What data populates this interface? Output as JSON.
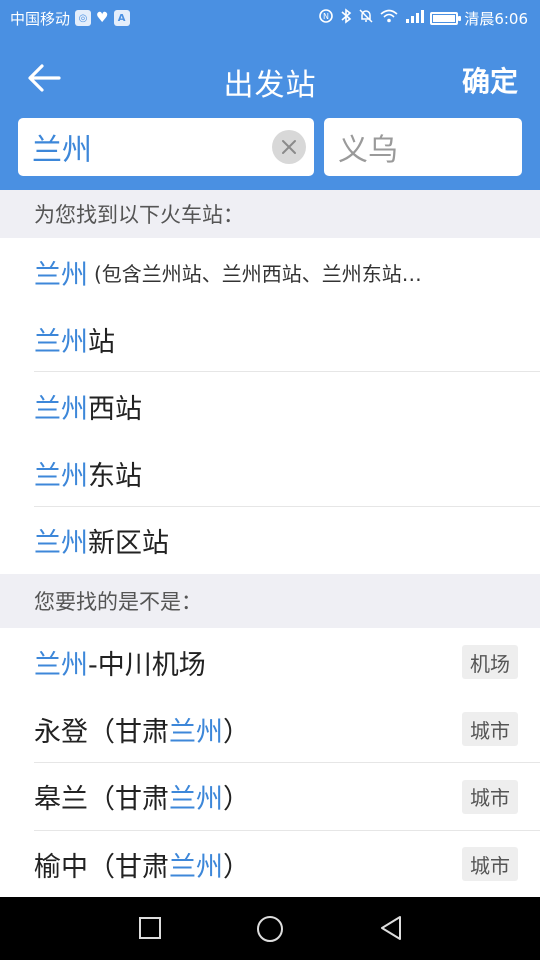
{
  "status_bar": {
    "carrier": "中国移动",
    "box1": "◎",
    "box2": "A",
    "time": "清晨6:06"
  },
  "header": {
    "title": "出发站",
    "confirm_label": "确定"
  },
  "search": {
    "from_value": "兰州",
    "to_value": "义乌"
  },
  "section1": {
    "header": "为您找到以下火车站："
  },
  "stations": [
    {
      "highlight": "兰州",
      "text": "(包含兰州站、兰州西站、兰州东站…"
    },
    {
      "highlight": "兰州",
      "text": "站"
    },
    {
      "highlight": "兰州",
      "text": "西站"
    },
    {
      "highlight": "兰州",
      "text": "东站"
    },
    {
      "highlight": "兰州",
      "text": "新区站"
    }
  ],
  "section2": {
    "header": "您要找的是不是："
  },
  "suggestions": [
    {
      "pre": "",
      "highlight": "兰州",
      "post": "-中川机场",
      "tag": "机场"
    },
    {
      "pre": "永登（甘肃",
      "highlight": "兰州",
      "post": "）",
      "tag": "城市"
    },
    {
      "pre": "皋兰（甘肃",
      "highlight": "兰州",
      "post": "）",
      "tag": "城市"
    },
    {
      "pre": "榆中（甘肃",
      "highlight": "兰州",
      "post": "）",
      "tag": "城市"
    }
  ],
  "colors": {
    "primary": "#4a90e2",
    "highlight": "#3d87d9",
    "section_bg": "#efeff4"
  },
  "icons": {
    "back": "arrow-left-icon",
    "clear": "clear-icon",
    "nav_recent": "square-icon",
    "nav_home": "circle-icon",
    "nav_back": "triangle-back-icon"
  }
}
